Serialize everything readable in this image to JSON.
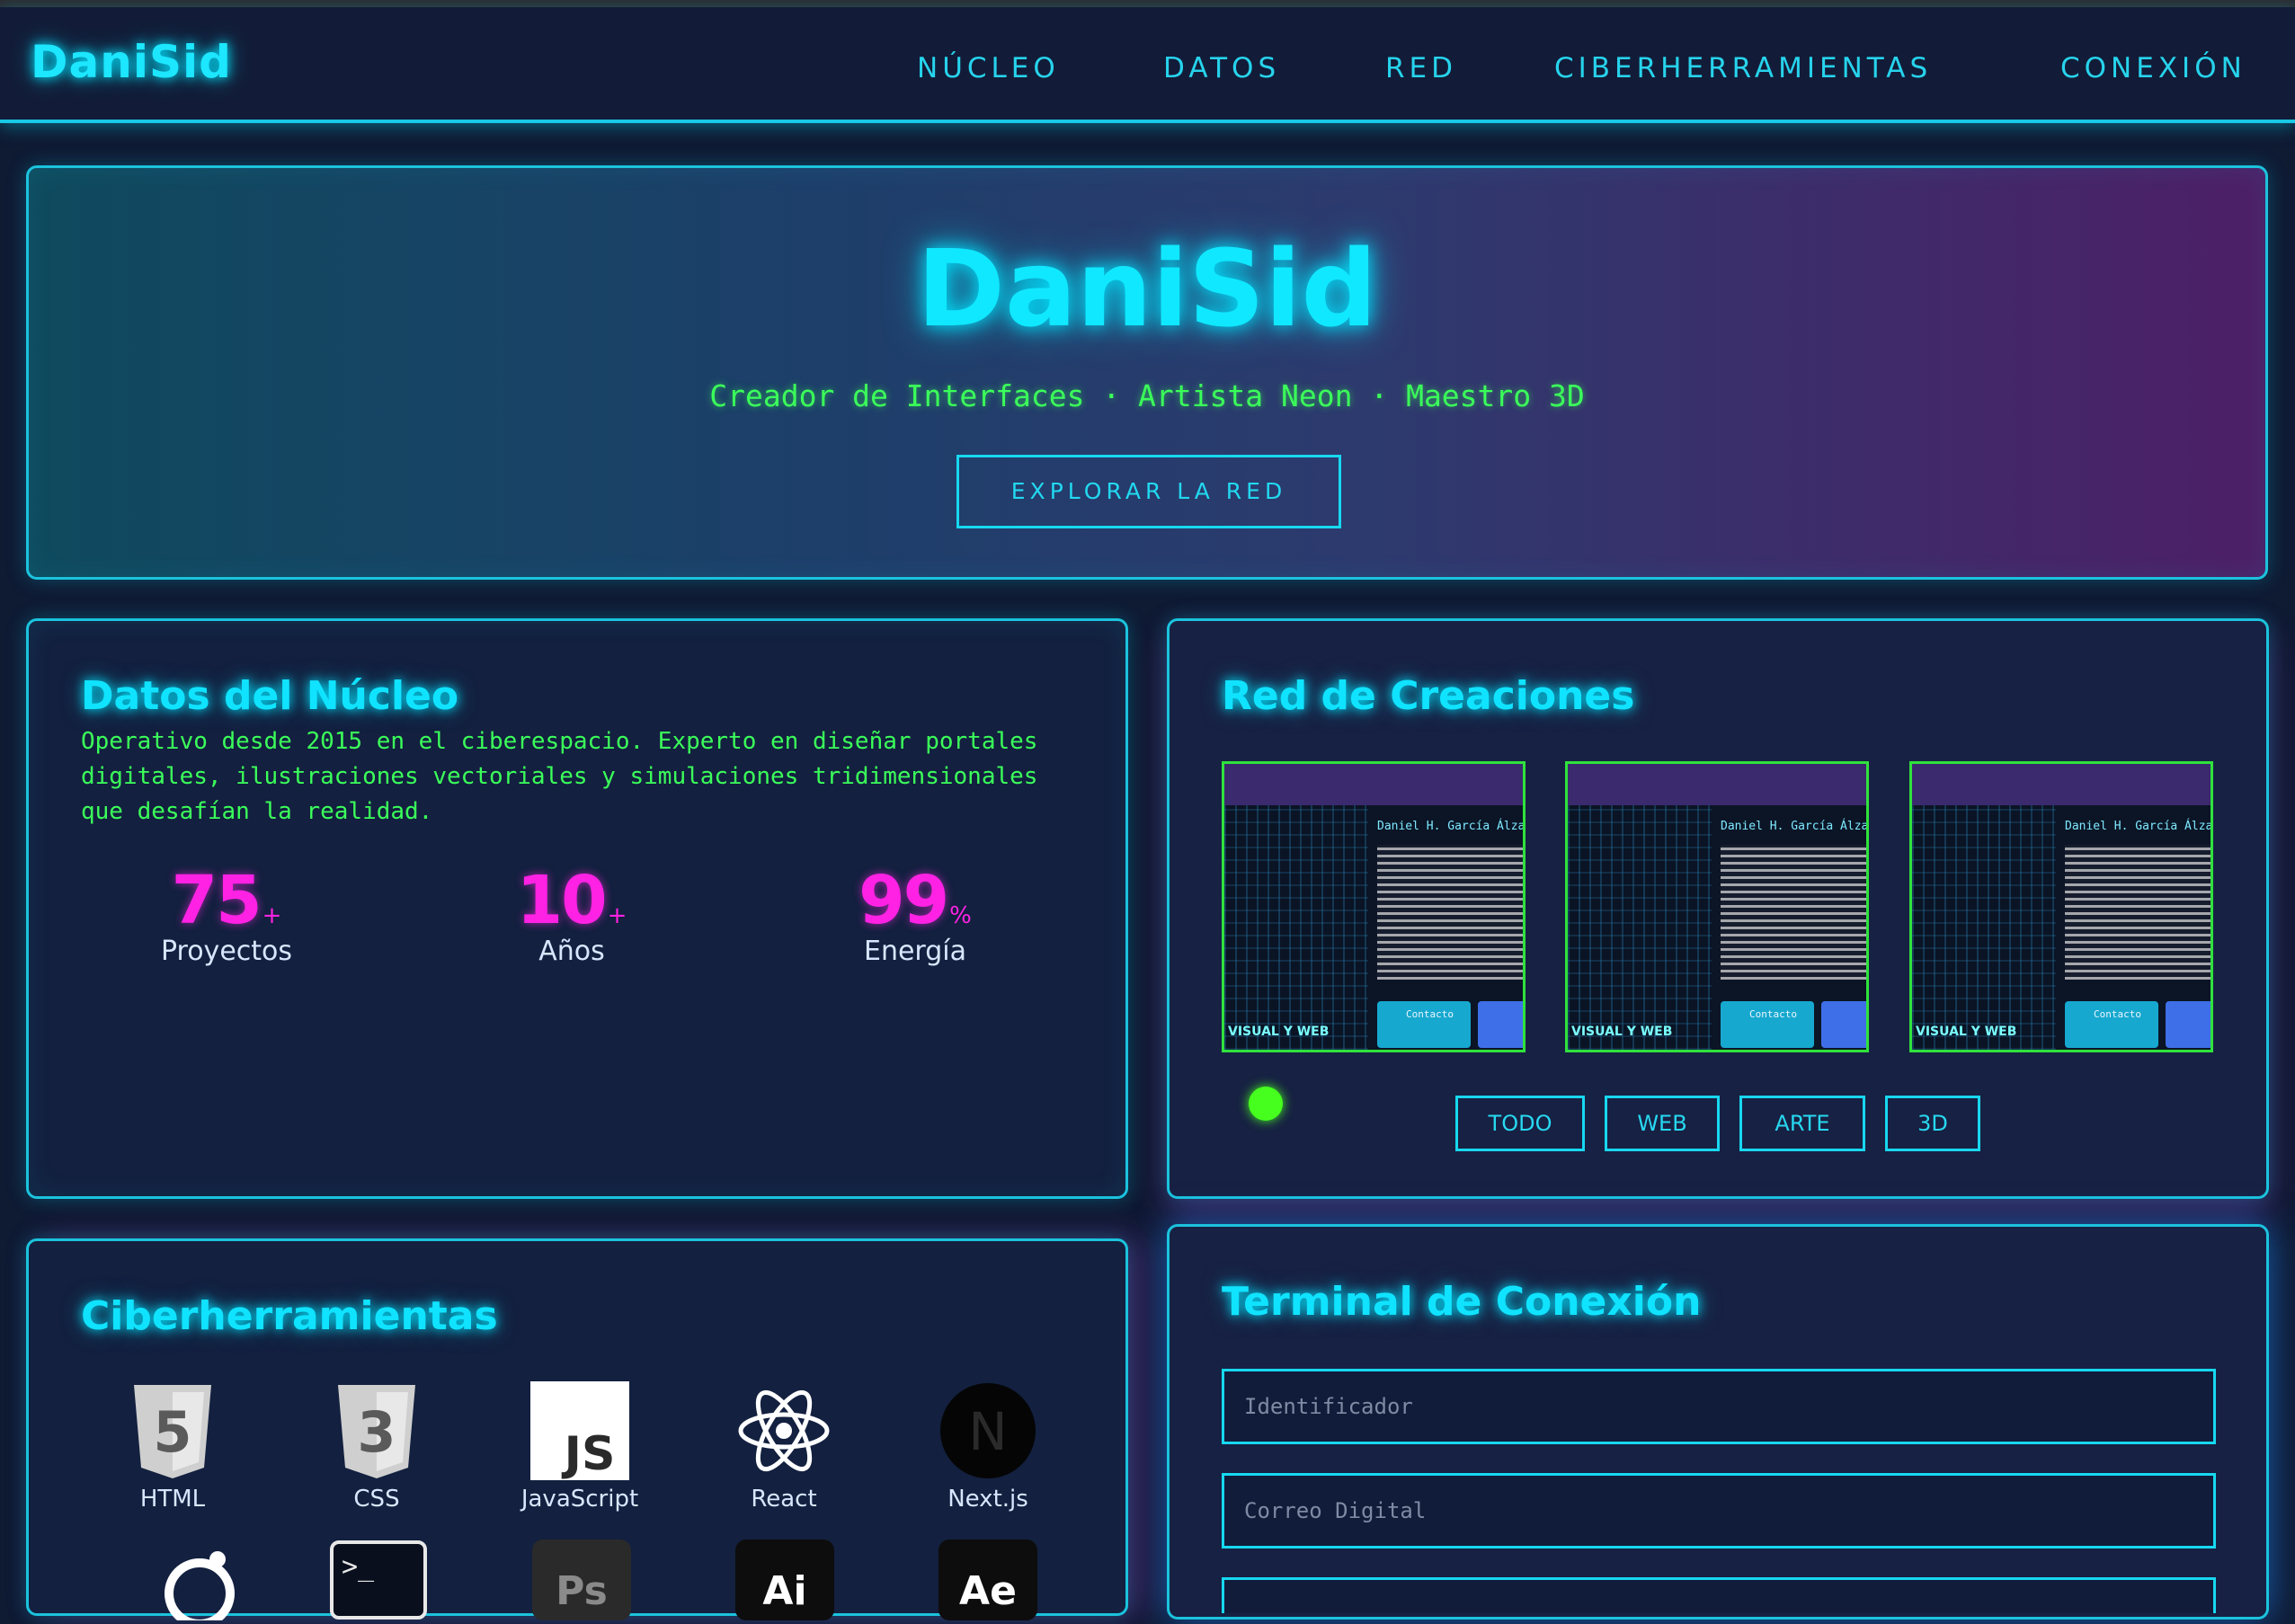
{
  "app": {
    "logo": "DaniSid"
  },
  "nav": {
    "items": [
      {
        "label": "NÚCLEO"
      },
      {
        "label": "DATOS"
      },
      {
        "label": "RED"
      },
      {
        "label": "CIBERHERRAMIENTAS"
      },
      {
        "label": "CONEXIÓN"
      }
    ]
  },
  "hero": {
    "title": "DaniSid",
    "subtitle": "Creador de Interfaces · Artista Neon · Maestro 3D",
    "button": "EXPLORAR LA RED"
  },
  "core": {
    "title": "Datos del Núcleo",
    "text": "Operativo desde 2015 en el ciberespacio. Experto en diseñar portales digitales, ilustraciones vectoriales y simulaciones tridimensionales que desafían la realidad.",
    "stats": [
      {
        "value": "75",
        "suffix": "+",
        "label": "Proyectos"
      },
      {
        "value": "10",
        "suffix": "+",
        "label": "Años"
      },
      {
        "value": "99",
        "suffix": "%",
        "label": "Energía"
      }
    ]
  },
  "network": {
    "title": "Red de Creaciones",
    "thumbs": [
      {
        "name": "Daniel H. García Álzat",
        "button": "Contacto",
        "tag": "VISUAL Y WEB"
      },
      {
        "name": "Daniel H. García Álzat",
        "button": "Contacto",
        "tag": "VISUAL Y WEB"
      },
      {
        "name": "Daniel H. García Álzat",
        "button": "Contacto",
        "tag": "VISUAL Y WEB"
      }
    ],
    "filters": [
      "TODO",
      "WEB",
      "ARTE",
      "3D"
    ]
  },
  "tools": {
    "title": "Ciberherramientas",
    "items": [
      {
        "label": "HTML",
        "icon": "html5-icon"
      },
      {
        "label": "CSS",
        "icon": "css3-icon"
      },
      {
        "label": "JavaScript",
        "icon": "javascript-icon"
      },
      {
        "label": "React",
        "icon": "react-icon"
      },
      {
        "label": "Next.js",
        "icon": "nextjs-icon"
      }
    ],
    "second_row_icons": [
      "ubuntu-icon",
      "terminal-icon",
      "photoshop-icon",
      "illustrator-icon",
      "after-effects-icon"
    ],
    "glyphs": {
      "html": "5",
      "css": "3",
      "js": "JS",
      "next": "N",
      "term": ">_",
      "ps": "Ps",
      "ai": "Ai",
      "ae": "Ae"
    }
  },
  "terminal": {
    "title": "Terminal de Conexión",
    "fields": [
      {
        "placeholder": "Identificador"
      },
      {
        "placeholder": "Correo Digital"
      }
    ]
  },
  "colors": {
    "cyan": "#00e5ff",
    "green": "#3bff5a",
    "magenta": "#ff22e4",
    "background": "#0f1a33"
  }
}
